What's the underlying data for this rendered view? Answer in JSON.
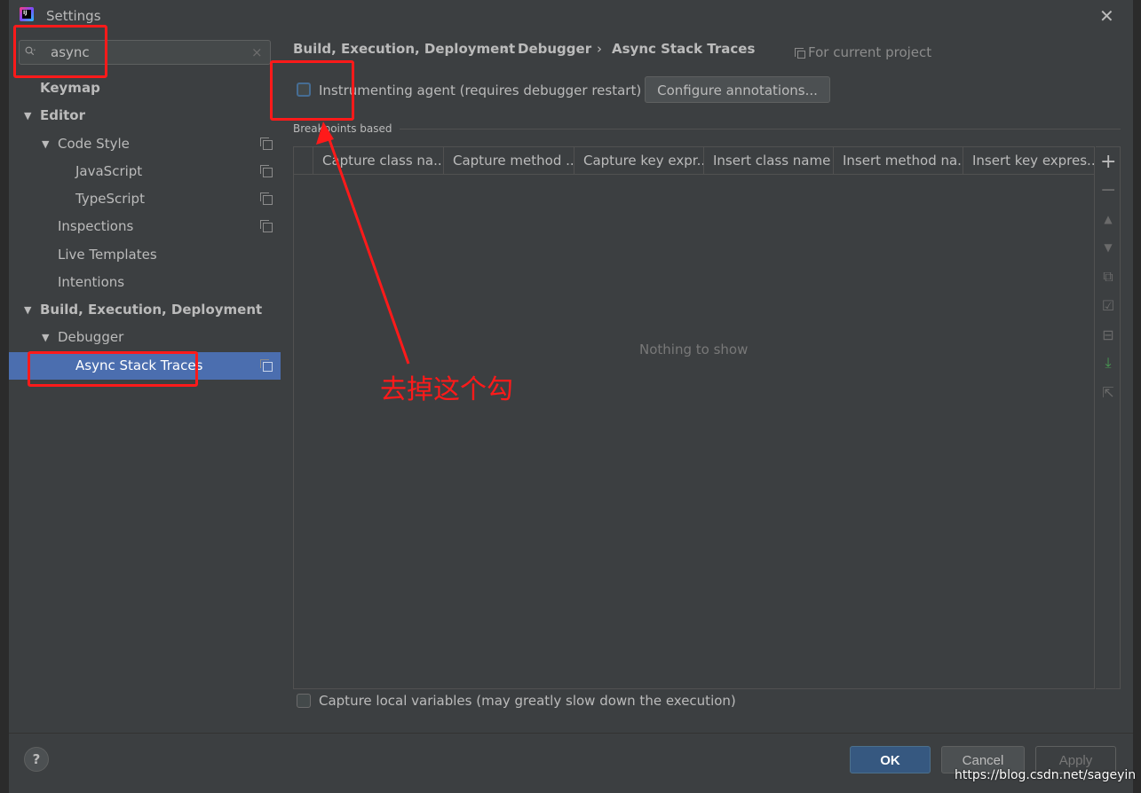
{
  "window": {
    "title": "Settings"
  },
  "search": {
    "value": "async"
  },
  "sidebar": {
    "items": [
      {
        "label": "Keymap"
      },
      {
        "label": "Editor"
      },
      {
        "label": "Code Style"
      },
      {
        "label": "JavaScript"
      },
      {
        "label": "TypeScript"
      },
      {
        "label": "Inspections"
      },
      {
        "label": "Live Templates"
      },
      {
        "label": "Intentions"
      },
      {
        "label": "Build, Execution, Deployment"
      },
      {
        "label": "Debugger"
      },
      {
        "label": "Async Stack Traces"
      }
    ]
  },
  "breadcrumb": {
    "items": [
      "Build, Execution, Deployment",
      "Debugger",
      "Async Stack Traces"
    ],
    "separator": "›",
    "scope": "For current project"
  },
  "instrumenting": {
    "label": "Instrumenting agent (requires debugger restart)",
    "checked": false,
    "configure_label": "Configure annotations..."
  },
  "section": {
    "title": "Breakpoints based"
  },
  "table": {
    "columns": [
      "Capture class na...",
      "Capture method ...",
      "Capture key expr...",
      "Insert class name",
      "Insert method na...",
      "Insert key expres..."
    ],
    "empty_text": "Nothing to show"
  },
  "toolbar": {
    "icons": [
      "add-icon",
      "remove-icon",
      "move-up-icon",
      "move-down-icon",
      "copy-icon",
      "check-icon",
      "collapse-icon",
      "import-icon",
      "export-icon"
    ],
    "add_glyph": "+",
    "remove_glyph": "−"
  },
  "capture_local": {
    "label": "Capture local variables (may greatly slow down the execution)",
    "checked": false
  },
  "footer": {
    "help": "?",
    "ok": "OK",
    "cancel": "Cancel",
    "apply": "Apply"
  },
  "annotation": {
    "note": "去掉这个勾"
  },
  "watermark": "https://blog.csdn.net/sageyin",
  "colors": {
    "background": "#3c3f41",
    "selection": "#4b6eaf",
    "ok_button": "#365880",
    "annotation_red": "#ff1a1a"
  }
}
